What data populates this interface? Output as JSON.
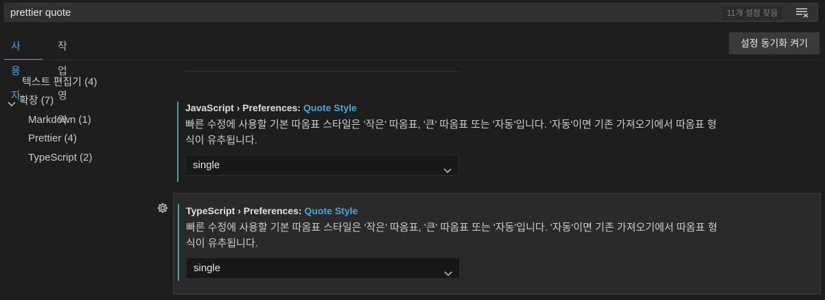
{
  "search": {
    "value": "prettier quote",
    "count": "11개 설정 찾음"
  },
  "tabs": [
    {
      "label": "사용자"
    },
    {
      "label": "작업 영역"
    }
  ],
  "sync_button": "설정 동기화 켜기",
  "sidebar": {
    "items": [
      {
        "label": "텍스트 편집기 (4)"
      },
      {
        "label": "확장 (7)"
      },
      {
        "label": "Markdown (1)"
      },
      {
        "label": "Prettier (4)"
      },
      {
        "label": "TypeScript (2)"
      }
    ]
  },
  "settings": [
    {
      "category": "JavaScript › Preferences: ",
      "key": "Quote Style",
      "desc_line1": "빠른 수정에 사용할 기본 따옴표 스타일은 '작은' 따옴표, '큰' 따옴표 또는 '자동'입니다. '자동'이면 기존 가져오기에서 따옴표 형",
      "desc_line2": "식이 유추됩니다.",
      "value": "single"
    },
    {
      "category": "TypeScript › Preferences: ",
      "key": "Quote Style",
      "desc_line1": "빠른 수정에 사용할 기본 따옴표 스타일은 '작은' 따옴표, '큰' 따옴표 또는 '자동'입니다. '자동'이면 기존 가져오기에서 따옴표 형",
      "desc_line2": "식이 유추됩니다.",
      "value": "single"
    }
  ],
  "colors": {
    "accent": "#4aa7d8",
    "modified_bar": "#3fa6a0",
    "background": "#1e1e1e"
  },
  "icons": [
    "filter-clear-icon",
    "chevron-down-icon",
    "gear-icon"
  ]
}
